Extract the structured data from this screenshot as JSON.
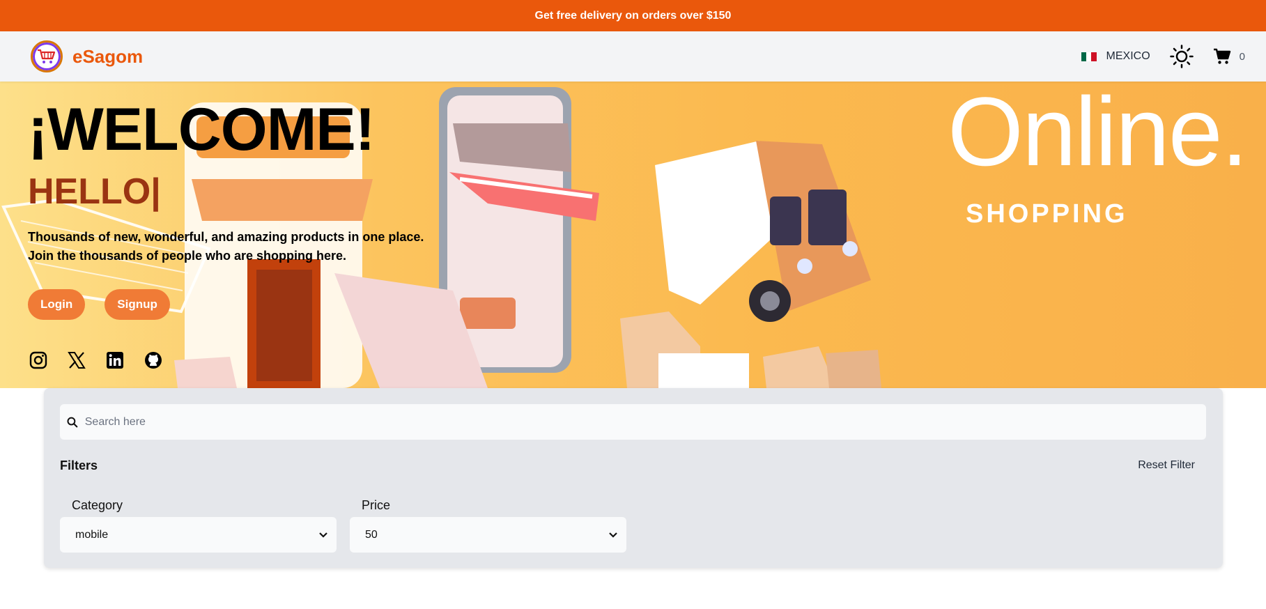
{
  "promo": {
    "text": "Get free delivery on orders over $150"
  },
  "navbar": {
    "brand": "eSagom",
    "country": "MEXICO",
    "cart_count": "0"
  },
  "hero": {
    "welcome": "¡WELCOME!",
    "hello": "HELLO|",
    "tagline_line1": "Thousands of new, wonderful, and amazing products in one place.",
    "tagline_line2": "Join the thousands of people who are shopping here.",
    "login_label": "Login",
    "signup_label": "Signup",
    "online_text": "Online.",
    "shopping_text": "SHOPPING",
    "socials": [
      "instagram-icon",
      "x-icon",
      "linkedin-icon",
      "github-icon"
    ]
  },
  "filters": {
    "search_placeholder": "Search here",
    "title": "Filters",
    "reset_label": "Reset Filter",
    "category_label": "Category",
    "category_value": "mobile",
    "price_label": "Price",
    "price_value": "50"
  },
  "colors": {
    "accent": "#ea580c",
    "button": "#f07b36",
    "hello": "#9a3412",
    "panel": "#e5e7eb"
  }
}
